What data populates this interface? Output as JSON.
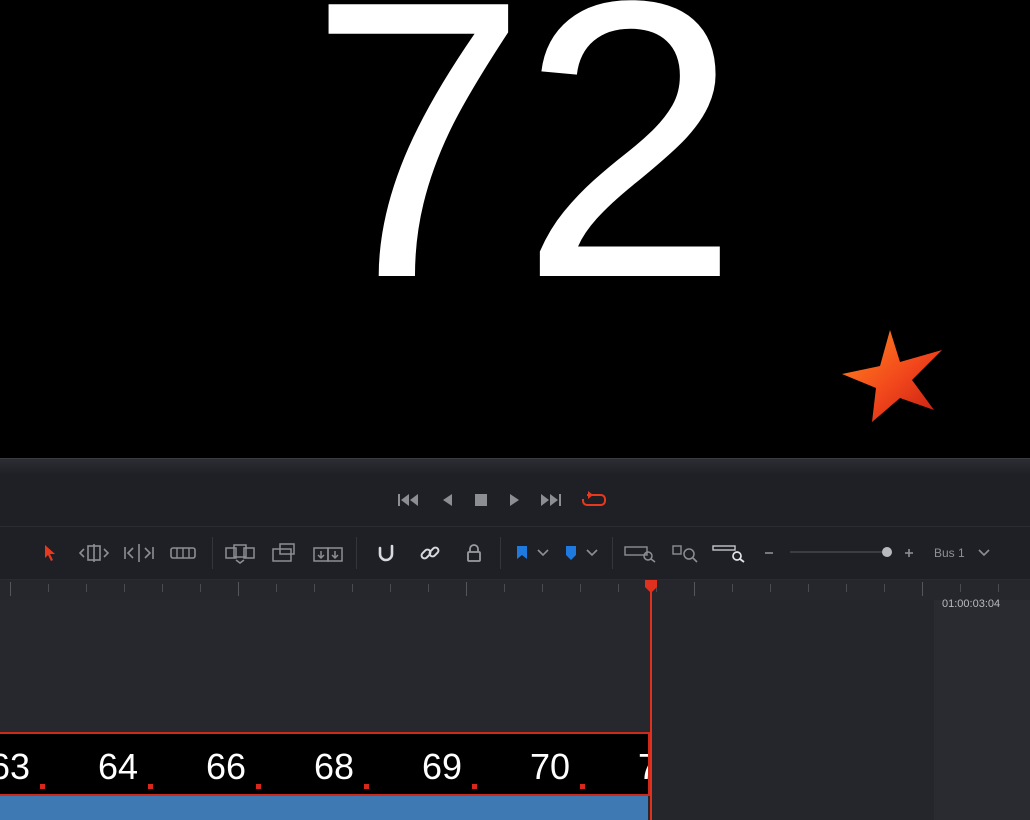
{
  "viewer": {
    "frame_number": "72"
  },
  "transport": {
    "buttons": [
      "skip-to-start",
      "play-reverse",
      "stop",
      "play",
      "skip-to-end",
      "loop"
    ],
    "accent_color": "#e8391f"
  },
  "toolbar": {
    "bus_label": "Bus 1",
    "zoom_level": 0.95,
    "flag_color": "#1f7ae0"
  },
  "timeline": {
    "timecode": "01:00:03:04",
    "frame_labels": [
      "63",
      "64",
      "66",
      "68",
      "69",
      "70",
      "7"
    ],
    "playhead_color": "#e0301e",
    "audio_clip_color": "#3f79b4"
  }
}
